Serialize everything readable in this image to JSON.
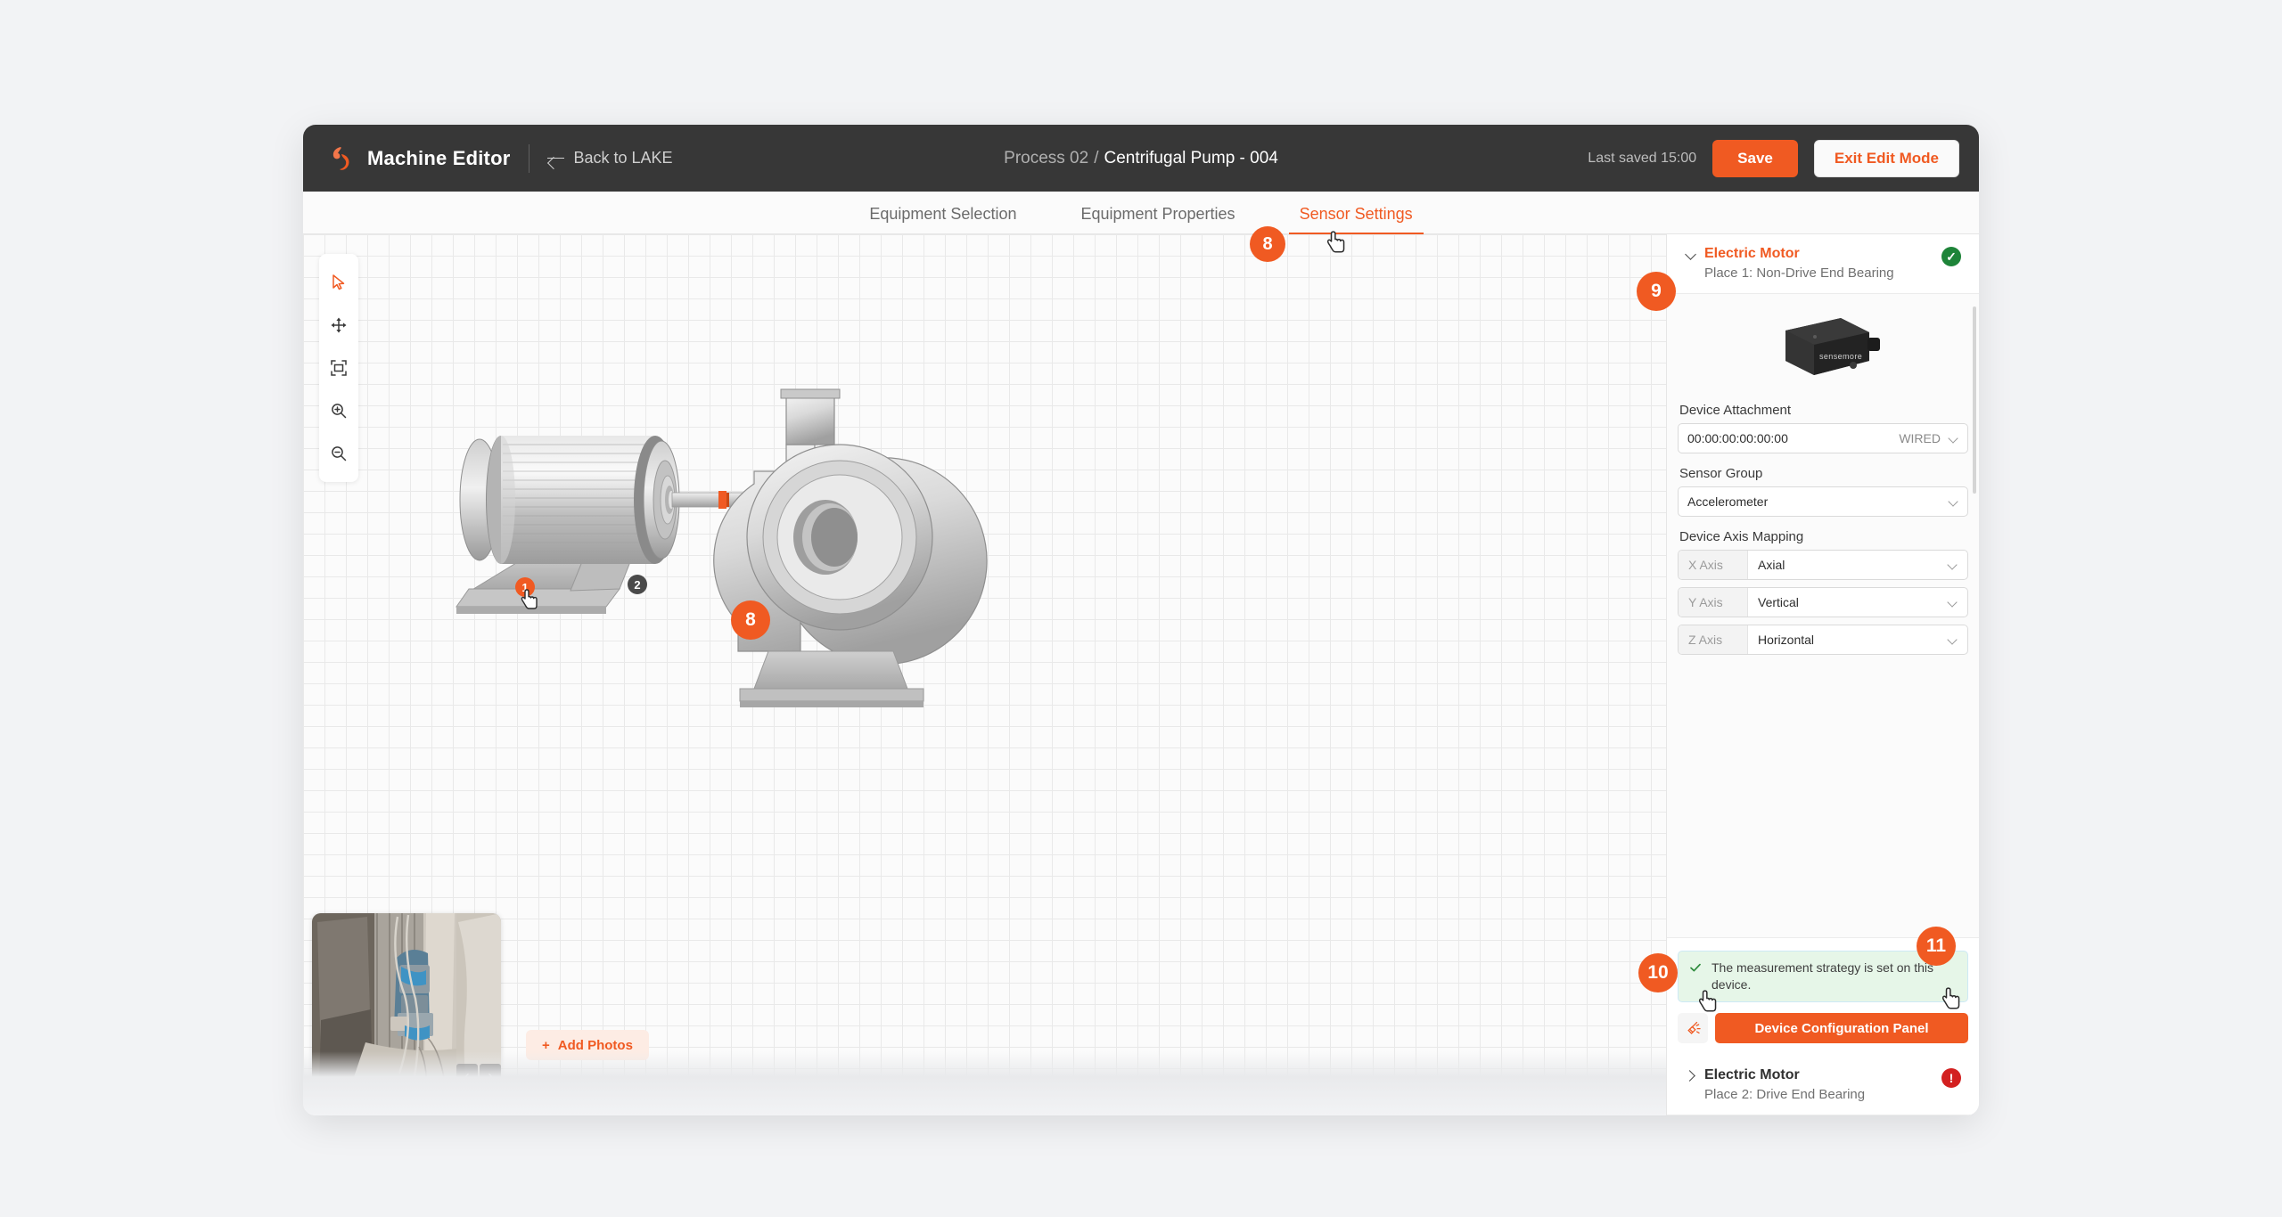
{
  "header": {
    "brand": "Machine Editor",
    "back_label": "Back to LAKE",
    "breadcrumb_parent": "Process 02",
    "breadcrumb_sep": "/",
    "breadcrumb_current": "Centrifugal Pump - 004",
    "last_saved": "Last saved 15:00",
    "save_label": "Save",
    "exit_label": "Exit Edit Mode",
    "accent_color": "#f05a22",
    "topbar_color": "#373737"
  },
  "tabs": [
    {
      "label": "Equipment Selection",
      "active": false
    },
    {
      "label": "Equipment Properties",
      "active": false
    },
    {
      "label": "Sensor Settings",
      "active": true
    }
  ],
  "toolbar": {
    "items": [
      {
        "icon": "select-cursor-icon",
        "active": true
      },
      {
        "icon": "move-icon",
        "active": false
      },
      {
        "icon": "fit-to-screen-icon",
        "active": false
      },
      {
        "icon": "zoom-in-icon",
        "active": false
      },
      {
        "icon": "zoom-out-icon",
        "active": false
      }
    ]
  },
  "canvas": {
    "machine_markers": [
      {
        "label": "1",
        "style": "orange"
      },
      {
        "label": "2",
        "style": "dark"
      }
    ],
    "photos": {
      "dot_count": 4,
      "active_dot": 0,
      "prev_label": "‹",
      "next_label": "›",
      "add_photos_label": "Add Photos",
      "add_photos_plus": "+"
    }
  },
  "panel": {
    "selected": {
      "title": "Electric Motor",
      "subtitle": "Place 1: Non-Drive End Bearing",
      "status": "ok",
      "status_glyph": "✓",
      "status_color": "#1e8439",
      "device_image_brand": "sensemore",
      "fields": [
        {
          "label": "Device Attachment",
          "value": "00:00:00:00:00:00",
          "suffix": "WIRED",
          "type": "input-select"
        },
        {
          "label": "Sensor Group",
          "value": "Accelerometer",
          "suffix": "",
          "type": "select"
        }
      ],
      "axis_mapping_label": "Device Axis Mapping",
      "axes": [
        {
          "tag": "X Axis",
          "value": "Axial"
        },
        {
          "tag": "Y Axis",
          "value": "Vertical"
        },
        {
          "tag": "Z Axis",
          "value": "Horizontal"
        }
      ],
      "alert": {
        "text": "The measurement strategy is set on this device.",
        "type": "success",
        "glyph": "✓"
      },
      "broom_icon": "clear-broom-icon",
      "device_config_label": "Device Configuration Panel"
    },
    "next_item": {
      "title": "Electric Motor",
      "subtitle": "Place 2: Drive End Bearing",
      "status": "error",
      "status_glyph": "!",
      "status_color": "#d32020"
    }
  },
  "steps": [
    {
      "label": "8",
      "target": "sensor-settings-tab"
    },
    {
      "label": "8",
      "target": "motor-marker-1"
    },
    {
      "label": "9",
      "target": "electric-motor-card"
    },
    {
      "label": "10",
      "target": "broom-button"
    },
    {
      "label": "11",
      "target": "measurement-alert"
    }
  ]
}
